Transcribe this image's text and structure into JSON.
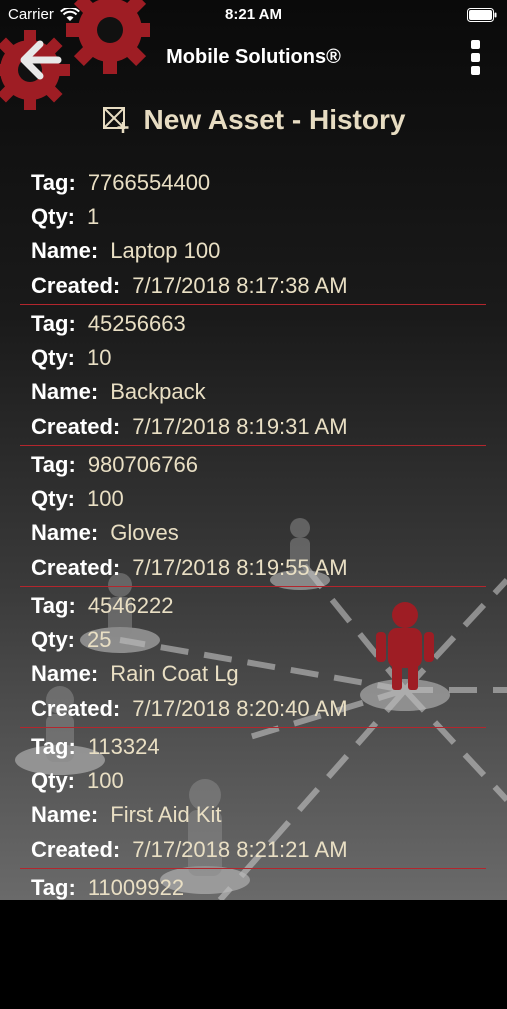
{
  "status_bar": {
    "carrier": "Carrier",
    "time": "8:21 AM"
  },
  "nav": {
    "title": "Mobile Solutions®",
    "back_icon": "back-arrow-icon",
    "menu_icon": "vertical-dots-icon"
  },
  "header": {
    "icon": "add-box-icon",
    "title": "New Asset - History"
  },
  "labels": {
    "tag": "Tag:",
    "qty": "Qty:",
    "name": "Name:",
    "created": "Created:"
  },
  "records": [
    {
      "tag": "7766554400",
      "qty": "1",
      "name": "Laptop 100",
      "created": "7/17/2018 8:17:38 AM"
    },
    {
      "tag": "45256663",
      "qty": "10",
      "name": "Backpack",
      "created": "7/17/2018 8:19:31 AM"
    },
    {
      "tag": "980706766",
      "qty": "100",
      "name": "Gloves",
      "created": "7/17/2018 8:19:55 AM"
    },
    {
      "tag": "4546222",
      "qty": "25",
      "name": "Rain Coat Lg",
      "created": "7/17/2018 8:20:40 AM"
    },
    {
      "tag": "113324",
      "qty": "100",
      "name": "First Aid Kit",
      "created": "7/17/2018 8:21:21 AM"
    },
    {
      "tag": "11009922"
    }
  ],
  "colors": {
    "accent": "#b3262d",
    "value_text": "#e9dfc4",
    "header_text": "#e7dcc2"
  }
}
